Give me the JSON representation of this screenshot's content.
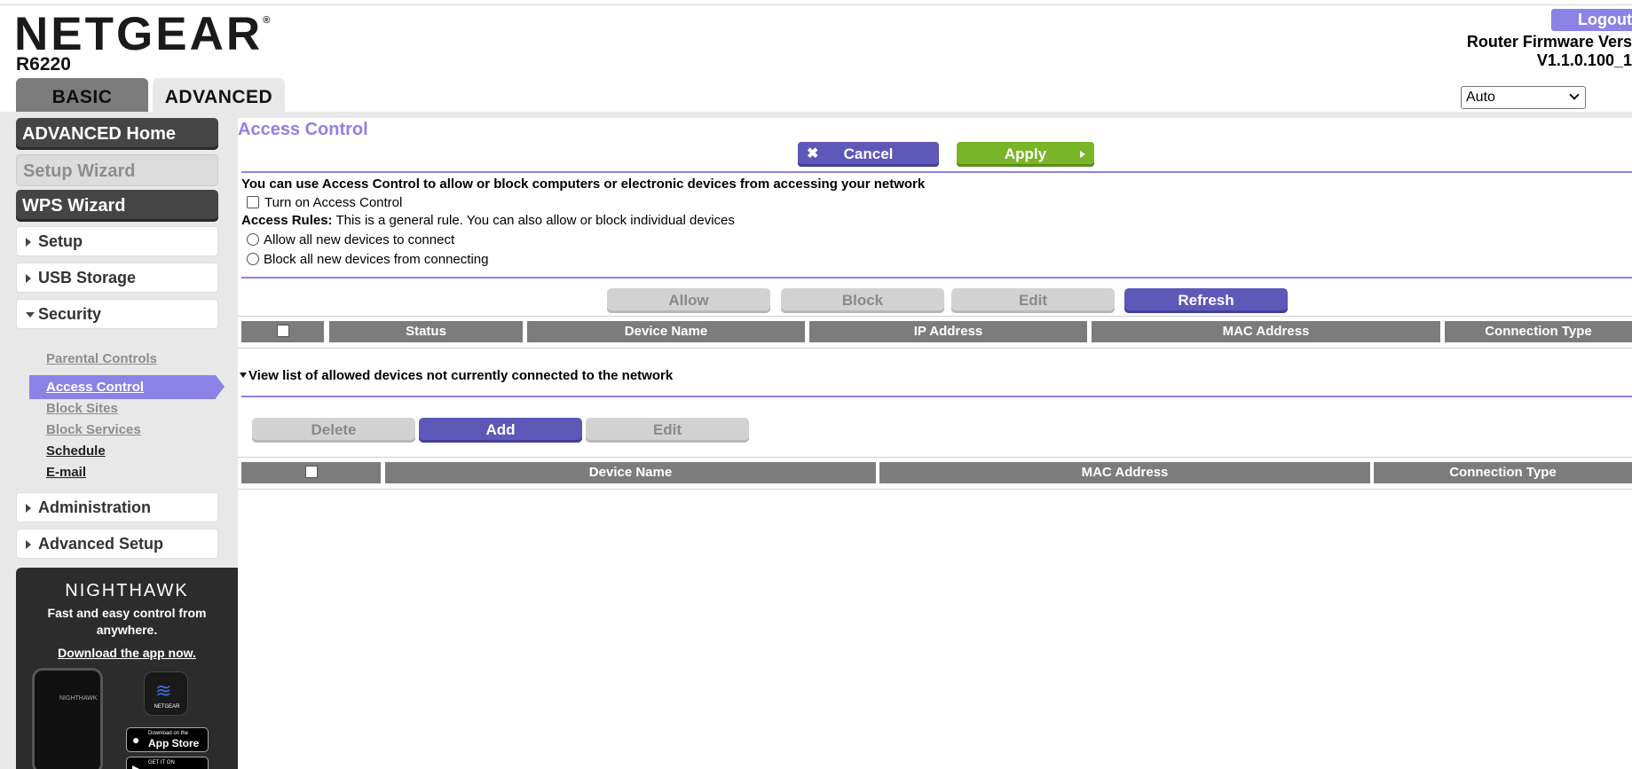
{
  "header": {
    "brand": "NETGEAR",
    "model": "R6220",
    "logout_label": "Logout",
    "firmware_label": "Router Firmware Vers",
    "firmware_value": "V1.1.0.100_1",
    "tabs": [
      {
        "label": "BASIC"
      },
      {
        "label": "ADVANCED"
      }
    ],
    "language_selected": "Auto"
  },
  "sidebar": {
    "advanced_home": "ADVANCED Home",
    "setup_wizard": "Setup Wizard",
    "wps_wizard": "WPS Wizard",
    "menus": [
      {
        "label": "Setup"
      },
      {
        "label": "USB Storage"
      },
      {
        "label": "Security"
      },
      {
        "label": "Administration"
      },
      {
        "label": "Advanced Setup"
      }
    ],
    "security_items": [
      {
        "label": "Parental Controls"
      },
      {
        "label": "Access Control"
      },
      {
        "label": "Block Sites"
      },
      {
        "label": "Block Services"
      },
      {
        "label": "Schedule"
      },
      {
        "label": "E-mail"
      }
    ],
    "promo": {
      "title": "NIGHTHAWK",
      "tagline": "Fast and easy control from anywhere.",
      "download": "Download the app now.",
      "phone_text": "NIGHTHAWK",
      "app_brand": "NETGEAR",
      "appstore_small": "Download on the",
      "appstore_big": "App Store",
      "googleplay_small": "GET IT ON"
    }
  },
  "main": {
    "title": "Access Control",
    "cancel_label": "Cancel",
    "apply_label": "Apply",
    "intro": "You can use Access Control to allow or block computers or electronic devices from accessing your network",
    "turn_on_label": "Turn on Access Control",
    "access_rules_label": "Access Rules:",
    "access_rules_text": " This is a general rule. You can also allow or block individual devices",
    "radio_allow": "Allow all new devices to connect",
    "radio_block": "Block all new devices from connecting",
    "device_buttons": {
      "allow": "Allow",
      "block": "Block",
      "edit": "Edit",
      "refresh": "Refresh"
    },
    "device_table_headers": [
      "Status",
      "Device Name",
      "IP Address",
      "MAC Address",
      "Connection Type"
    ],
    "collapse_label": "View list of allowed devices not currently connected to the network",
    "allowed_buttons": {
      "delete": "Delete",
      "add": "Add",
      "edit": "Edit"
    },
    "allowed_table_headers": [
      "Device Name",
      "MAC Address",
      "Connection Type"
    ]
  },
  "colors": {
    "accent_purple": "#8c82e6",
    "button_purple": "#5e58b8",
    "apply_green": "#78b528",
    "header_gray": "#7c7c7c"
  }
}
